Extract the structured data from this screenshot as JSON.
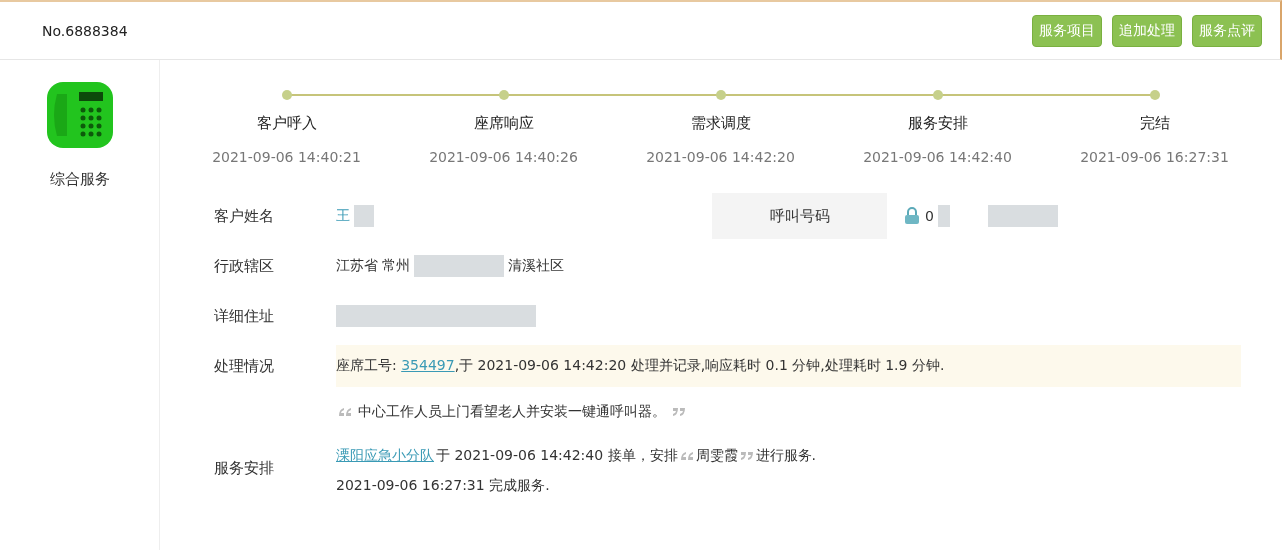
{
  "record_no": "No.6888384",
  "actions": [
    "服务项目",
    "追加处理",
    "服务点评"
  ],
  "category": {
    "label": "综合服务"
  },
  "steps": [
    {
      "label": "客户呼入",
      "time": "2021-09-06 14:40:21"
    },
    {
      "label": "座席响应",
      "time": "2021-09-06 14:40:26"
    },
    {
      "label": "需求调度",
      "time": "2021-09-06 14:42:20"
    },
    {
      "label": "服务安排",
      "time": "2021-09-06 14:42:40"
    },
    {
      "label": "完结",
      "time": "2021-09-06 16:27:31"
    }
  ],
  "customer_name": {
    "label": "客户姓名",
    "value": "王"
  },
  "call_number": {
    "label": "呼叫号码",
    "value": "0"
  },
  "district": {
    "label": "行政辖区",
    "value_start": "江苏省 常州",
    "value_end": "清溪社区"
  },
  "address": {
    "label": "详细住址"
  },
  "processing": {
    "label": "处理情况",
    "prefix": "座席工号: ",
    "agent_id": "354497",
    "text": ",于 2021-09-06 14:42:20 处理并记录,响应耗时 0.1 分钟,处理耗时 1.9 分钟.",
    "note": "中心工作人员上门看望老人并安装一键通呼叫器。"
  },
  "arrangement": {
    "label": "服务安排",
    "team": "溧阳应急小分队",
    "text_before": " 于 2021-09-06 14:42:40 接单，安排 ",
    "staff": "周雯霞",
    "text_after": " 进行服务.",
    "completed": "2021-09-06 16:27:31 完成服务."
  }
}
